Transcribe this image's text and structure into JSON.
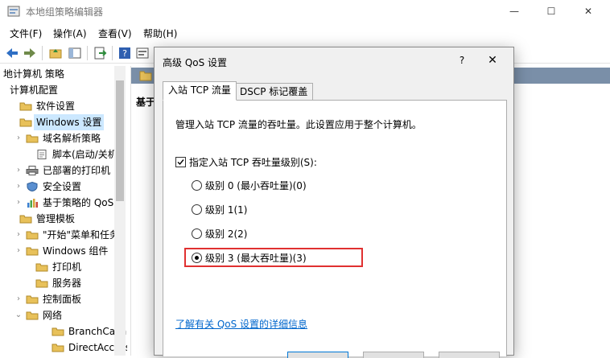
{
  "window": {
    "title": "本地组策略编辑器",
    "controls": {
      "minimize": "—",
      "maximize": "☐",
      "close": "✕"
    }
  },
  "menu": [
    "文件(F)",
    "操作(A)",
    "查看(V)",
    "帮助(H)"
  ],
  "tree": {
    "items": [
      {
        "label": "地计算机 策略",
        "icon": "none",
        "expander": ""
      },
      {
        "label": "计算机配置",
        "icon": "none",
        "expander": ""
      },
      {
        "label": "软件设置",
        "icon": "folder-icon",
        "expander": ""
      },
      {
        "label": "Windows 设置",
        "icon": "folder-icon",
        "expander": "",
        "selected": true
      },
      {
        "label": "域名解析策略",
        "icon": "folder-icon",
        "expander": ">"
      },
      {
        "label": "脚本(启动/关机)",
        "icon": "script-icon",
        "expander": ""
      },
      {
        "label": "已部署的打印机",
        "icon": "printer-icon",
        "expander": ">"
      },
      {
        "label": "安全设置",
        "icon": "shield-icon",
        "expander": ">"
      },
      {
        "label": "基于策略的 QoS",
        "icon": "chart-icon",
        "expander": ">"
      },
      {
        "label": "管理模板",
        "icon": "folder-icon",
        "expander": ""
      },
      {
        "label": "\"开始\"菜单和任务",
        "icon": "folder-icon",
        "expander": ">"
      },
      {
        "label": "Windows 组件",
        "icon": "folder-icon",
        "expander": ">"
      },
      {
        "label": "打印机",
        "icon": "folder-icon",
        "expander": ""
      },
      {
        "label": "服务器",
        "icon": "folder-icon",
        "expander": ""
      },
      {
        "label": "控制面板",
        "icon": "folder-icon",
        "expander": ">"
      },
      {
        "label": "网络",
        "icon": "folder-icon",
        "expander": "v"
      },
      {
        "label": "BranchCache",
        "icon": "folder-icon",
        "expander": ""
      },
      {
        "label": "DirectAccess",
        "icon": "folder-icon",
        "expander": ""
      }
    ]
  },
  "right_pane": {
    "label": "基于"
  },
  "dialog": {
    "title": "高级 QoS 设置",
    "help": "?",
    "close": "✕",
    "tabs": [
      "入站 TCP 流量",
      "DSCP 标记覆盖"
    ],
    "active_tab": 0,
    "description": "管理入站 TCP 流量的吞吐量。此设置应用于整个计算机。",
    "checkbox": {
      "label": "指定入站 TCP 吞吐量级别(S):",
      "checked": true
    },
    "radios": [
      {
        "label": "级别 0 (最小吞吐量)(0)",
        "selected": false
      },
      {
        "label": "级别 1(1)",
        "selected": false
      },
      {
        "label": "级别 2(2)",
        "selected": false
      },
      {
        "label": "级别 3 (最大吞吐量)(3)",
        "selected": true
      }
    ],
    "link": "了解有关 QoS 设置的详细信息",
    "highlight_color": "#e03030"
  }
}
